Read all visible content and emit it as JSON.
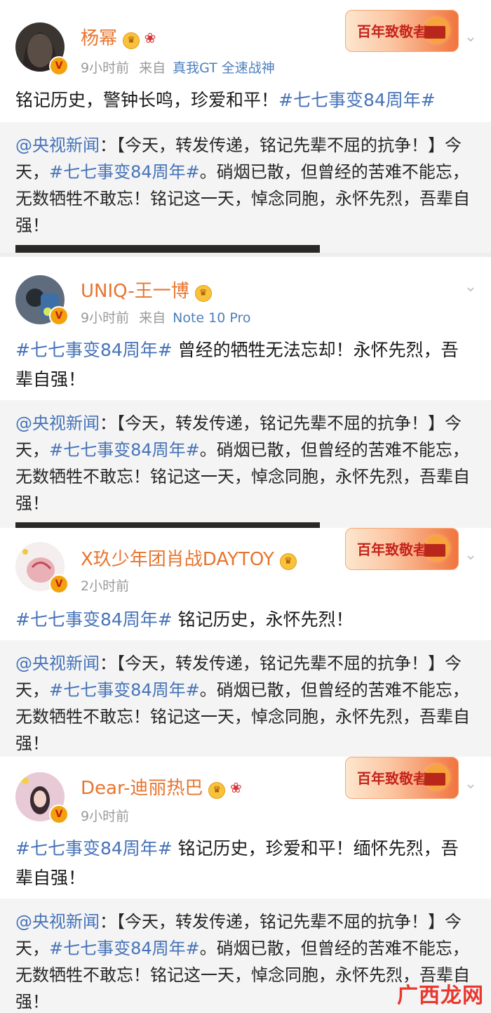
{
  "posts": [
    {
      "name": "杨幂",
      "time": "9小时前",
      "from_label": "来自",
      "source": "真我GT 全速战神",
      "text_tag": "",
      "text_body": "铭记历史，警钟长鸣，珍爱和平！",
      "text_tag_end": "#七七事变84周年#",
      "has_banner": true,
      "repost": {
        "author": "@央视新闻",
        "before_tag": "：【今天，转发传递，铭记先辈不屈的抗争！】今天，",
        "tag": "#七七事变84周年#",
        "after_tag": "。硝烟已散，但曾经的苦难不能忘，无数牺牲不敢忘！铭记这一天，悼念同胞，永怀先烈，吾辈自强！"
      }
    },
    {
      "name": "UNIQ-王一博",
      "time": "9小时前",
      "from_label": "来自",
      "source": "Note 10 Pro",
      "text_tag": "#七七事变84周年#",
      "text_body": " 曾经的牺牲无法忘却！永怀先烈，吾辈自强！",
      "has_banner": false,
      "repost": {
        "author": "@央视新闻",
        "before_tag": "：【今天，转发传递，铭记先辈不屈的抗争！】今天，",
        "tag": "#七七事变84周年#",
        "after_tag": "。硝烟已散，但曾经的苦难不能忘，无数牺牲不敢忘！铭记这一天，悼念同胞，永怀先烈，吾辈自强！"
      }
    },
    {
      "name": "X玖少年团肖战DAYTOY",
      "time": "2小时前",
      "text_tag": "#七七事变84周年#",
      "text_body": " 铭记历史，永怀先烈！",
      "has_banner": true,
      "repost": {
        "author": "@央视新闻",
        "before_tag": "：【今天，转发传递，铭记先辈不屈的抗争！】今天，",
        "tag": "#七七事变84周年#",
        "after_tag": "。硝烟已散，但曾经的苦难不能忘，无数牺牲不敢忘！铭记这一天，悼念同胞，永怀先烈，吾辈自强！"
      }
    },
    {
      "name": "Dear-迪丽热巴",
      "time": "9小时前",
      "text_tag": "#七七事变84周年#",
      "text_body": " 铭记历史，珍爱和平！缅怀先烈，吾辈自强！",
      "has_banner": true,
      "repost": {
        "author": "@央视新闻",
        "before_tag": "：【今天，转发传递，铭记先辈不屈的抗争！】今天，",
        "tag": "#七七事变84周年#",
        "after_tag": "。硝烟已散，但曾经的苦难不能忘，无数牺牲不敢忘！铭记这一天，悼念同胞，永怀先烈，吾辈自强！"
      }
    }
  ],
  "banner_text": "百年致敬者",
  "avatar_badge": "V",
  "crown_glyph": "♛",
  "ribbon_glyph": "❀",
  "chevron_glyph": "⌄",
  "watermark": "广西龙网",
  "colors": {
    "name": "#e8752f",
    "tag": "#4673b8",
    "meta": "#9a9a9a",
    "repost_bg": "#f4f4f4"
  }
}
